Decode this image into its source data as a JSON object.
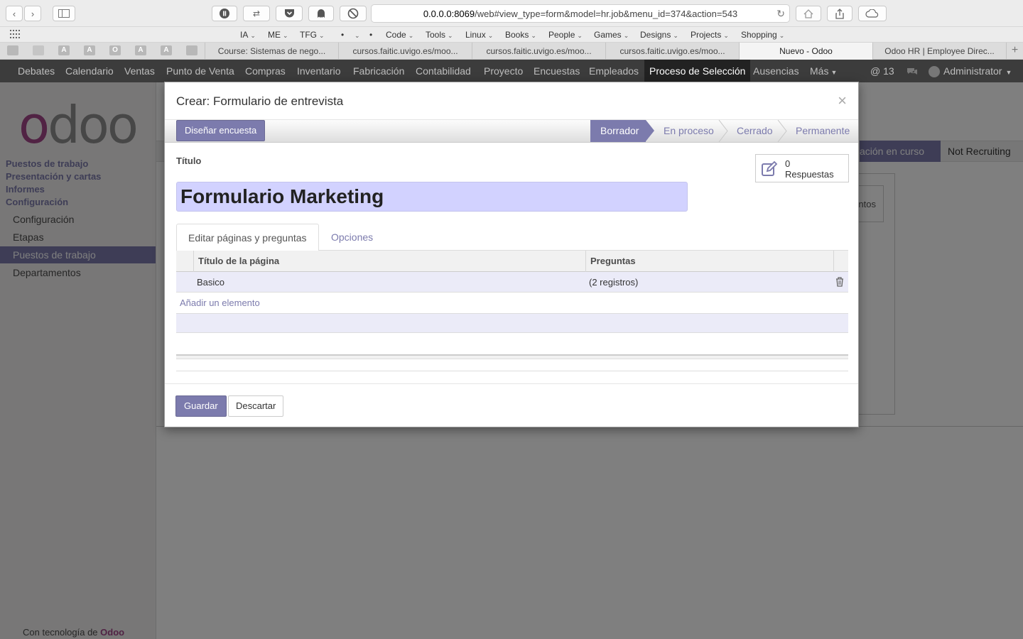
{
  "browser": {
    "url_host": "0.0.0.0:8069",
    "url_path": "/web#view_type=form&model=hr.job&menu_id=374&action=543",
    "bookmarks": [
      {
        "label": "IA",
        "has_menu": true
      },
      {
        "label": "ME",
        "has_menu": true
      },
      {
        "label": "TFG",
        "has_menu": true
      },
      {
        "label": "•",
        "has_menu": false
      },
      {
        "label": "•",
        "has_menu": true
      },
      {
        "label": "•",
        "has_menu": false
      },
      {
        "label": "Code",
        "has_menu": true
      },
      {
        "label": "Tools",
        "has_menu": true
      },
      {
        "label": "Linux",
        "has_menu": true
      },
      {
        "label": "Books",
        "has_menu": true
      },
      {
        "label": "People",
        "has_menu": true
      },
      {
        "label": "Games",
        "has_menu": true
      },
      {
        "label": "Designs",
        "has_menu": true
      },
      {
        "label": "Projects",
        "has_menu": true
      },
      {
        "label": "Shopping",
        "has_menu": true
      }
    ],
    "pinned_tabs": [
      "",
      "",
      "A",
      "A",
      "O",
      "A",
      "A",
      ""
    ],
    "tabs": [
      {
        "label": "Course: Sistemas de nego...",
        "active": false
      },
      {
        "label": "cursos.faitic.uvigo.es/moo...",
        "active": false
      },
      {
        "label": "cursos.faitic.uvigo.es/moo...",
        "active": false
      },
      {
        "label": "cursos.faitic.uvigo.es/moo...",
        "active": false
      },
      {
        "label": "Nuevo - Odoo",
        "active": true
      },
      {
        "label": "Odoo HR | Employee Direc...",
        "active": false
      }
    ]
  },
  "navbar": {
    "items": [
      "Debates",
      "Calendario",
      "Ventas",
      "Punto de Venta",
      "Compras",
      "Inventario",
      "Fabricación",
      "Contabilidad",
      "Proyecto",
      "Encuestas",
      "Empleados",
      "Proceso de Selección",
      "Ausencias",
      "Más"
    ],
    "active": "Proceso de Selección",
    "notifications": "13",
    "user": "Administrator"
  },
  "sidebar": {
    "logo": "odoo",
    "sections": [
      "Puestos de trabajo",
      "Presentación y cartas",
      "Informes",
      "Configuración"
    ],
    "items": [
      {
        "label": "Configuración",
        "active": false
      },
      {
        "label": "Etapas",
        "active": false
      },
      {
        "label": "Puestos de trabajo",
        "active": true
      },
      {
        "label": "Departamentos",
        "active": false
      }
    ],
    "powered_prefix": "Con tecnología de",
    "powered_brand": "Odoo"
  },
  "background": {
    "stage_partial": "ación en curso",
    "stage_next": "Not Recruiting",
    "box_partial": "ntos"
  },
  "modal": {
    "title": "Crear: Formulario de entrevista",
    "design_button": "Diseñar encuesta",
    "stages": [
      "Borrador",
      "En proceso",
      "Cerrado",
      "Permanente"
    ],
    "current_stage": "Borrador",
    "field_label": "Título",
    "title_value": "Formulario Marketing",
    "stat_count": "0",
    "stat_label": "Respuestas",
    "tabs": [
      "Editar páginas y preguntas",
      "Opciones"
    ],
    "active_tab": "Editar páginas y preguntas",
    "columns": [
      "Título de la página",
      "Preguntas"
    ],
    "rows": [
      {
        "title": "Basico",
        "questions": "(2 registros)"
      }
    ],
    "add_item": "Añadir un elemento",
    "save_button": "Guardar",
    "discard_button": "Descartar"
  },
  "colors": {
    "primary": "#7c7bad",
    "brand": "#a24689",
    "navbar": "#3c3c3c",
    "title_field": "#d2d2ff"
  }
}
